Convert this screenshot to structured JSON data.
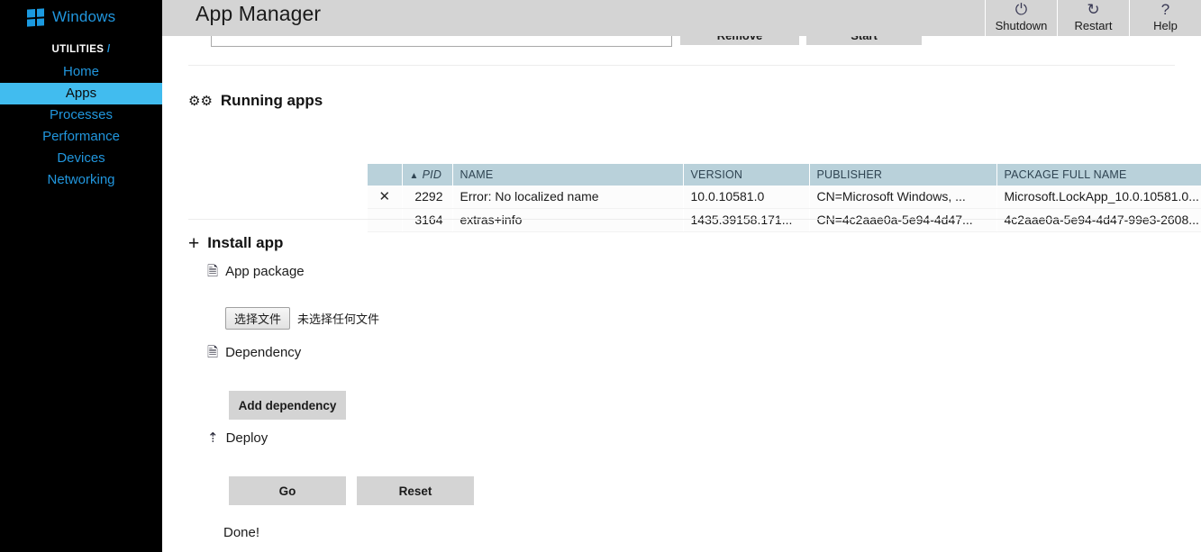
{
  "sidebar": {
    "brand": "Windows",
    "brand_icon": "windows-logo-icon",
    "section_label": "UTILITIES",
    "section_slash": "/",
    "items": [
      {
        "label": "Home",
        "active": false
      },
      {
        "label": "Apps",
        "active": true
      },
      {
        "label": "Processes",
        "active": false
      },
      {
        "label": "Performance",
        "active": false
      },
      {
        "label": "Devices",
        "active": false
      },
      {
        "label": "Networking",
        "active": false
      }
    ],
    "colors": {
      "background": "#000000",
      "link": "#2196dd",
      "active_bg": "#41bcef"
    }
  },
  "header": {
    "title": "App Manager",
    "background": "#d4d4d4",
    "actions": [
      {
        "label": "Shutdown",
        "icon": "power-icon",
        "glyph": "⏻"
      },
      {
        "label": "Restart",
        "icon": "restart-icon",
        "glyph": "↻"
      },
      {
        "label": "Help",
        "icon": "help-icon",
        "glyph": "?"
      }
    ]
  },
  "top_form": {
    "text_value": "",
    "remove_label": "Remove",
    "start_label": "Start"
  },
  "running_apps": {
    "heading": "Running apps",
    "heading_icon": "gears-icon",
    "columns": [
      {
        "key": "close",
        "label": "",
        "sorted": false
      },
      {
        "key": "pid",
        "label": "PID",
        "sorted": true,
        "caret": "▲"
      },
      {
        "key": "name",
        "label": "NAME",
        "sorted": false
      },
      {
        "key": "version",
        "label": "VERSION",
        "sorted": false
      },
      {
        "key": "publisher",
        "label": "PUBLISHER",
        "sorted": false
      },
      {
        "key": "package",
        "label": "PACKAGE FULL NAME",
        "sorted": false
      }
    ],
    "rows": [
      {
        "close_icon": "✕",
        "has_close": true,
        "pid": "2292",
        "name": "Error: No localized name",
        "version": "10.0.10581.0",
        "publisher": "CN=Microsoft Windows, ...",
        "package": "Microsoft.LockApp_10.0.10581.0..."
      },
      {
        "close_icon": "",
        "has_close": false,
        "pid": "3164",
        "name": "extras+info",
        "version": "1435.39158.171...",
        "publisher": "CN=4c2aae0a-5e94-4d47...",
        "package": "4c2aae0a-5e94-4d47-99e3-2608..."
      }
    ]
  },
  "install_app": {
    "heading": "Install app",
    "heading_icon": "plus-icon",
    "app_package": {
      "label": "App package",
      "icon": "file-icon",
      "choose_button": "选择文件",
      "file_name": "未选择任何文件"
    },
    "dependency": {
      "label": "Dependency",
      "icon": "file-icon",
      "add_button": "Add dependency"
    },
    "deploy": {
      "label": "Deploy",
      "icon": "upload-icon",
      "go_button": "Go",
      "reset_button": "Reset",
      "status": "Done!"
    }
  }
}
